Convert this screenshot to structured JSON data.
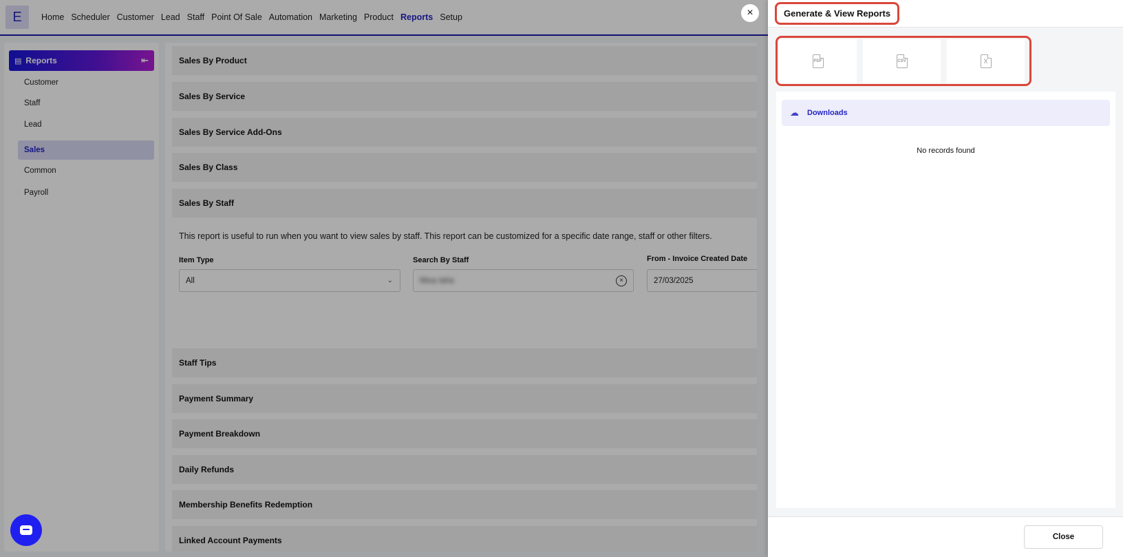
{
  "nav": {
    "logo": "E",
    "items": [
      "Home",
      "Scheduler",
      "Customer",
      "Lead",
      "Staff",
      "Point Of Sale",
      "Automation",
      "Marketing",
      "Product",
      "Reports",
      "Setup"
    ],
    "active": "Reports",
    "close_icon": "×"
  },
  "sidebar": {
    "title": "Reports",
    "items": [
      "Customer",
      "Staff",
      "Lead",
      "Sales",
      "Common",
      "Payroll"
    ],
    "active": "Sales"
  },
  "main": {
    "accordions_top": [
      "Sales By Product",
      "Sales By Service",
      "Sales By Service Add-Ons",
      "Sales By Class",
      "Sales By Staff"
    ],
    "description": "This report is useful to run when you want to view sales by staff. This report can be customized for a specific date range, staff or other filters.",
    "filters": {
      "item_type_label": "Item Type",
      "item_type_value": "All",
      "staff_label": "Search By Staff",
      "staff_value": "Mixa Iaha",
      "date_label": "From - Invoice Created Date",
      "date_value": "27/03/2025"
    },
    "accordions_bottom": [
      "Staff Tips",
      "Payment Summary",
      "Payment Breakdown",
      "Daily Refunds",
      "Membership Benefits Redemption",
      "Linked Account Payments"
    ]
  },
  "panel": {
    "title": "Generate & View Reports",
    "formats": [
      {
        "label": "PDF",
        "icon": "pdf-file-icon"
      },
      {
        "label": "CSV",
        "icon": "csv-file-icon"
      },
      {
        "label": "X",
        "icon": "excel-file-icon"
      }
    ],
    "downloads_label": "Downloads",
    "empty_text": "No records found",
    "close_label": "Close"
  },
  "colors": {
    "accent": "#2424c4",
    "highlight": "#d9473a",
    "chat": "#1f1ff0"
  }
}
